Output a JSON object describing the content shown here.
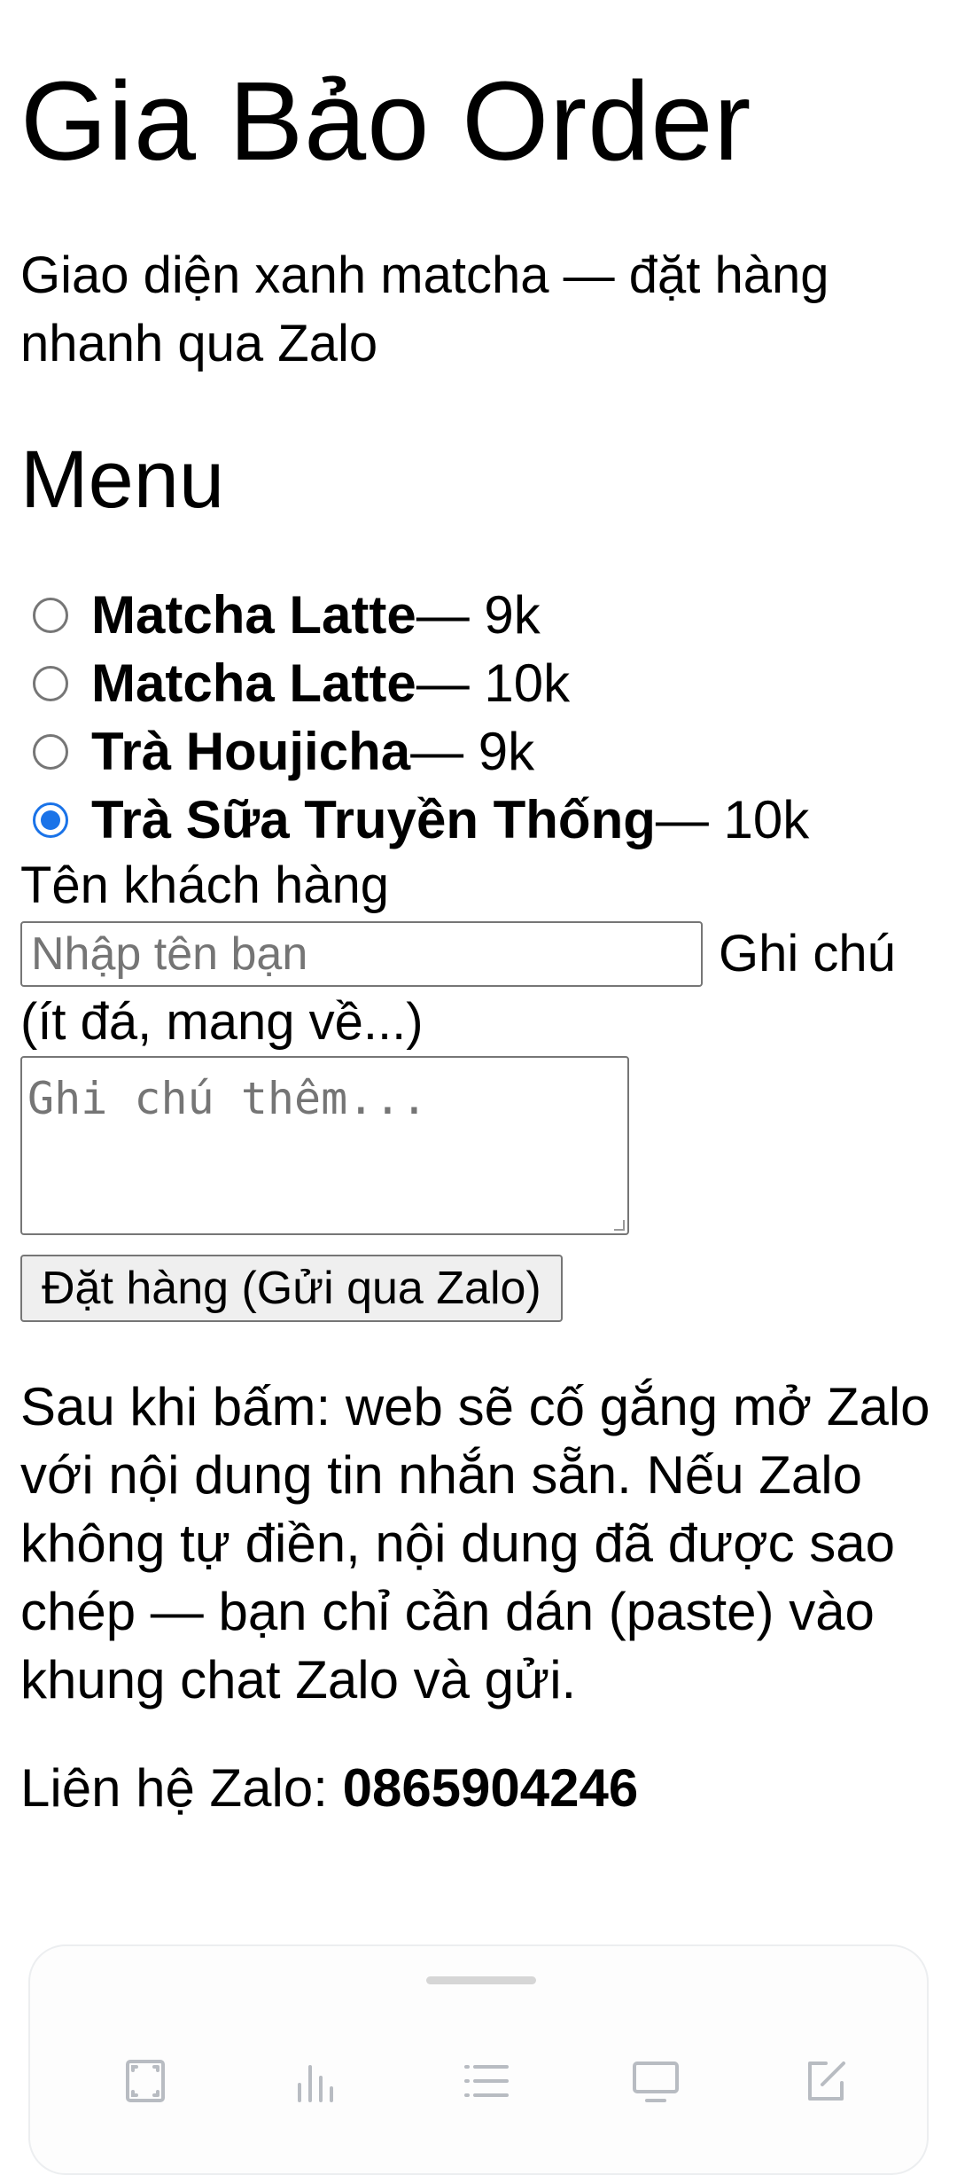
{
  "header": {
    "title": "Gia Bảo Order",
    "subtitle": "Giao diện xanh matcha — đặt hàng nhanh qua Zalo"
  },
  "menu": {
    "heading": "Menu",
    "items": [
      {
        "name": "Matcha Latte",
        "price": " — 9k",
        "selected": false
      },
      {
        "name": "Matcha Latte",
        "price": " — 10k",
        "selected": false
      },
      {
        "name": "Trà Houjicha",
        "price": " — 9k",
        "selected": false
      },
      {
        "name": "Trà Sữa Truyền Thống",
        "price": " — 10k",
        "selected": true
      }
    ]
  },
  "form": {
    "name_label": "Tên khách hàng",
    "name_placeholder": "Nhập tên bạn",
    "note_label_part1": "Ghi chú",
    "note_label_part2": "(ít đá, mang về...)",
    "note_placeholder": "Ghi chú thêm...",
    "submit_label": "Đặt hàng (Gửi qua Zalo)"
  },
  "info": {
    "text": "Sau khi bấm: web sẽ cố gắng mở Zalo với nội dung tin nhắn sẵn. Nếu Zalo không tự điền, nội dung đã được sao chép — bạn chỉ cần dán (paste) vào khung chat Zalo và gửi.",
    "contact_label": "Liên hệ Zalo: ",
    "contact_phone": "0865904246"
  },
  "bottom_sheet": {
    "tools": [
      "frame-icon",
      "bar-chart-icon",
      "list-icon",
      "monitor-icon",
      "edit-icon"
    ],
    "icon_color": "#b8bcc2"
  }
}
